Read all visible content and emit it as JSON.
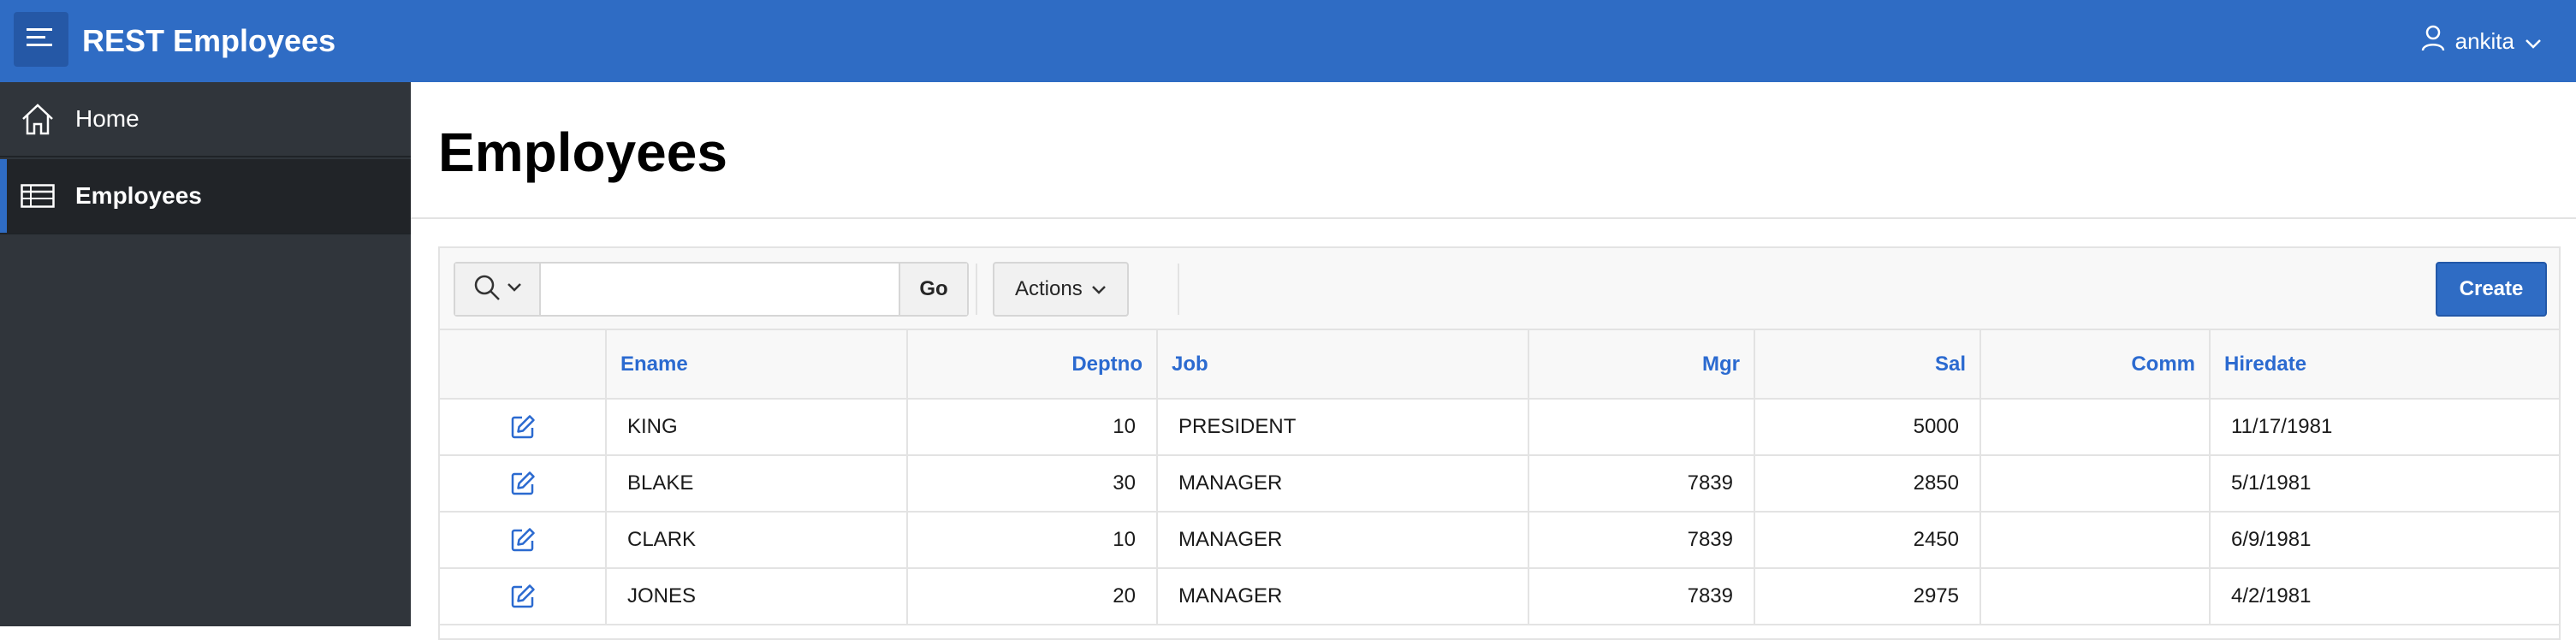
{
  "header": {
    "app_title": "REST Employees",
    "user": "ankita",
    "menu_icon": "hamburger-icon",
    "user_icon": "user-icon",
    "chevron_icon": "chevron-down-icon",
    "color": "#2f6cc4"
  },
  "sidebar": {
    "items": [
      {
        "label": "Home",
        "icon": "home-icon",
        "active": false
      },
      {
        "label": "Employees",
        "icon": "table-icon",
        "active": true
      }
    ]
  },
  "page": {
    "title": "Employees"
  },
  "report": {
    "search": {
      "placeholder": "",
      "value": "",
      "go_label": "Go",
      "icon": "search-icon"
    },
    "actions_label": "Actions",
    "create_label": "Create",
    "columns": [
      "",
      "Ename",
      "Deptno",
      "Job",
      "Mgr",
      "Sal",
      "Comm",
      "Hiredate"
    ],
    "rows": [
      {
        "ename": "KING",
        "deptno": "10",
        "job": "PRESIDENT",
        "mgr": "",
        "sal": "5000",
        "comm": "",
        "hiredate": "11/17/1981"
      },
      {
        "ename": "BLAKE",
        "deptno": "30",
        "job": "MANAGER",
        "mgr": "7839",
        "sal": "2850",
        "comm": "",
        "hiredate": "5/1/1981"
      },
      {
        "ename": "CLARK",
        "deptno": "10",
        "job": "MANAGER",
        "mgr": "7839",
        "sal": "2450",
        "comm": "",
        "hiredate": "6/9/1981"
      },
      {
        "ename": "JONES",
        "deptno": "20",
        "job": "MANAGER",
        "mgr": "7839",
        "sal": "2975",
        "comm": "",
        "hiredate": "4/2/1981"
      }
    ]
  }
}
